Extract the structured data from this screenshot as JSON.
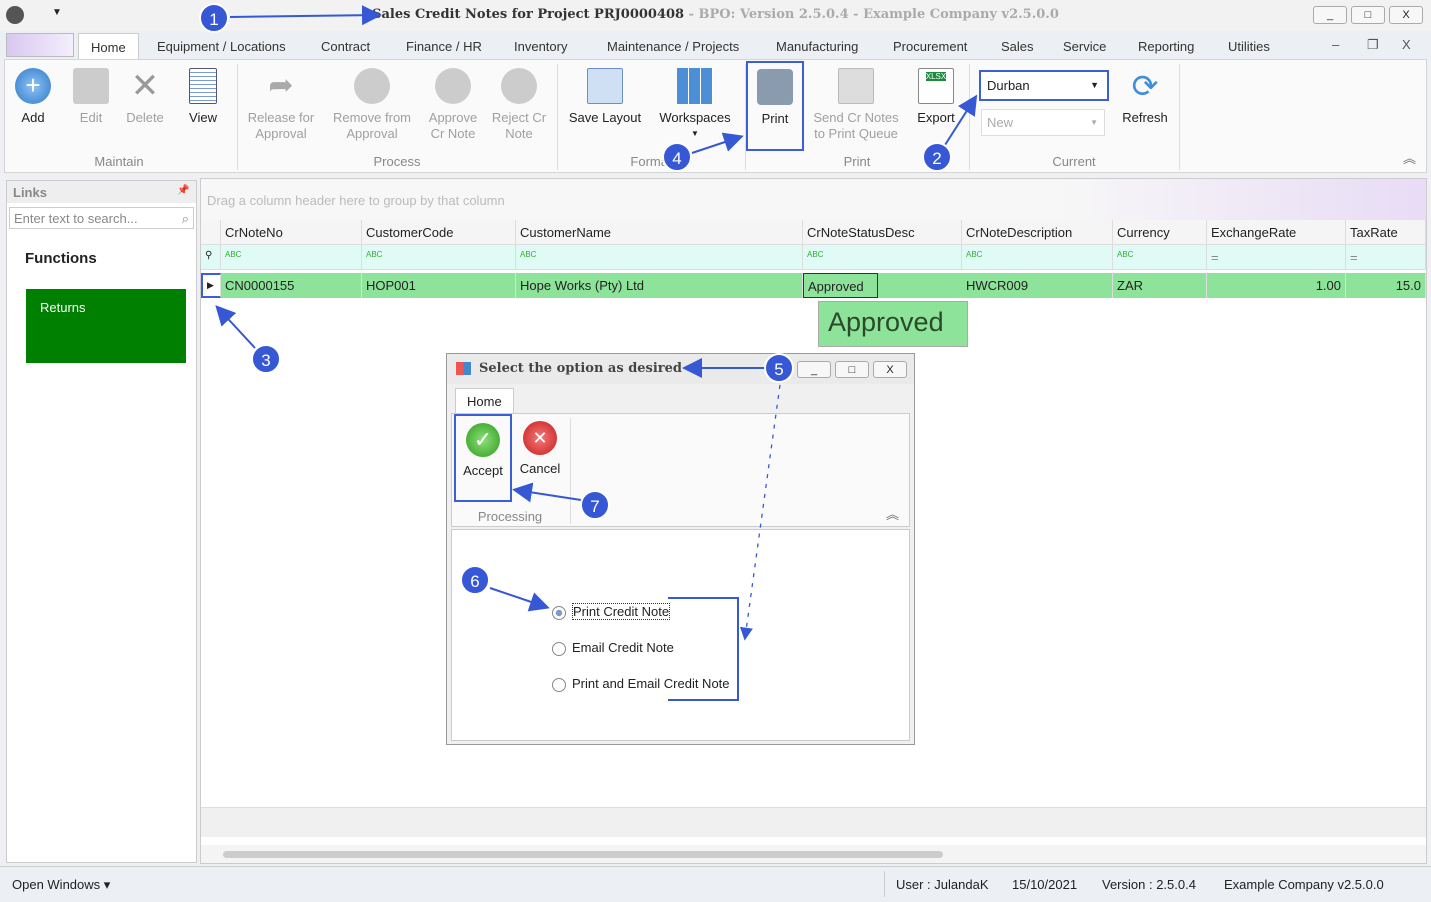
{
  "window": {
    "title": "Sales Credit Notes for Project PRJ0000408",
    "subtitle": " - BPO: Version 2.5.0.4 - Example Company v2.5.0.0",
    "min": "_",
    "max": "□",
    "close": "X"
  },
  "tabs": [
    "Home",
    "Equipment / Locations",
    "Contract",
    "Finance / HR",
    "Inventory",
    "Maintenance / Projects",
    "Manufacturing",
    "Procurement",
    "Sales",
    "Service",
    "Reporting",
    "Utilities"
  ],
  "ribbon": {
    "maintain": {
      "label": "Maintain",
      "add": "Add",
      "edit": "Edit",
      "delete": "Delete",
      "view": "View"
    },
    "process": {
      "label": "Process",
      "release": "Release for Approval",
      "remove": "Remove from Approval",
      "approve": "Approve Cr Note",
      "reject": "Reject Cr Note"
    },
    "format": {
      "label": "Format",
      "save_layout": "Save Layout",
      "workspaces": "Workspaces"
    },
    "print": {
      "label": "Print",
      "print": "Print",
      "send": "Send Cr Notes to Print Queue",
      "export": "Export",
      "xlsx": "XLSX"
    },
    "current": {
      "label": "Current",
      "site": "Durban",
      "status": "New",
      "refresh": "Refresh"
    }
  },
  "links": {
    "title": "Links",
    "search_placeholder": "Enter text to search...",
    "functions": "Functions",
    "returns": "Returns",
    "returns_color": "#008000"
  },
  "grid": {
    "group_hint": "Drag a column header here to group by that column",
    "columns": [
      "CrNoteNo",
      "CustomerCode",
      "CustomerName",
      "CrNoteStatusDesc",
      "CrNoteDescription",
      "Currency",
      "ExchangeRate",
      "TaxRate"
    ],
    "rows": [
      [
        "CN0000155",
        "HOP001",
        "Hope Works (Pty) Ltd",
        "Approved",
        "HWCR009",
        "ZAR",
        "1.00",
        "15.0"
      ]
    ],
    "tooltip": "Approved",
    "row_color": "#8ee39a"
  },
  "dialog": {
    "title": "Select the option as desired",
    "tab": "Home",
    "accept": "Accept",
    "cancel": "Cancel",
    "group": "Processing",
    "options": [
      "Print Credit Note",
      "Email Credit Note",
      "Print and Email Credit Note"
    ],
    "selected": "Print Credit Note"
  },
  "statusbar": {
    "open_windows": "Open Windows ▾",
    "user": "User : JulandaK",
    "date": "15/10/2021",
    "version": "Version : 2.5.0.4",
    "company": "Example Company v2.5.0.0"
  },
  "annotations": [
    "1",
    "2",
    "3",
    "4",
    "5",
    "6",
    "7"
  ],
  "accent": "#3658d4"
}
